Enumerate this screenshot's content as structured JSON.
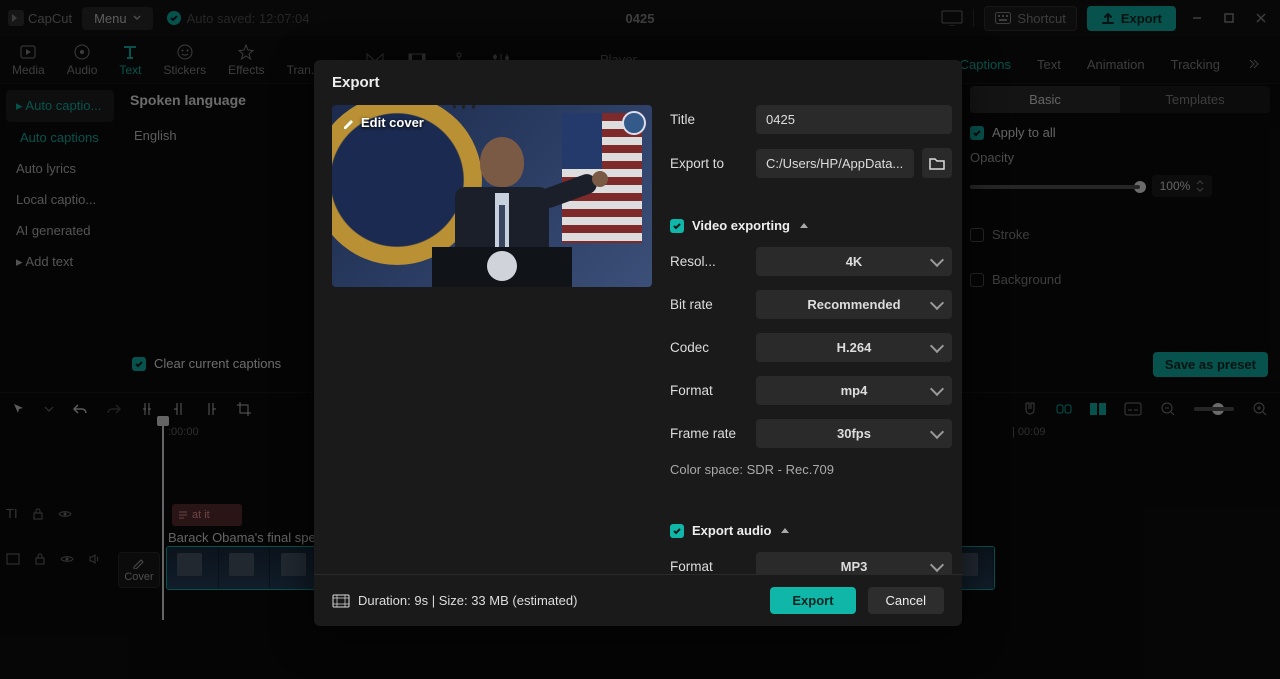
{
  "titlebar": {
    "brand": "CapCut",
    "menu": "Menu",
    "autosave": "Auto saved: 12:07:04",
    "document": "0425",
    "shortcut": "Shortcut",
    "export": "Export"
  },
  "toolTabs": {
    "media": "Media",
    "audio": "Audio",
    "text": "Text",
    "stickers": "Stickers",
    "effects": "Effects",
    "transitions": "Tran..."
  },
  "player_label": "Player",
  "rightTabs": {
    "captions": "Captions",
    "text": "Text",
    "animation": "Animation",
    "tracking": "Tracking"
  },
  "mediaSidebar": {
    "autoCaptionsPill": "▸ Auto captio...",
    "autoCaptions": "Auto captions",
    "autoLyrics": "Auto lyrics",
    "localCaptions": "Local captio...",
    "aiGenerated": "AI generated",
    "addText": "▸ Add text"
  },
  "langPanel": {
    "heading": "Spoken language",
    "value": "English"
  },
  "clearCaptions": "Clear current captions",
  "inspector": {
    "seg_basic": "Basic",
    "seg_templates": "Templates",
    "applyAll": "Apply to all",
    "opacity_label": "Opacity",
    "opacity_value": "100%",
    "stroke": "Stroke",
    "background": "Background",
    "savePreset": "Save as preset"
  },
  "timeline": {
    "marks": {
      "t0": ":00:00",
      "t9": "| 00:09"
    },
    "captionClip": "at it",
    "clipTitle": "Barack Obama's final speec",
    "coverBtn": "Cover"
  },
  "modal": {
    "title": "Export",
    "editCover": "Edit cover",
    "fields": {
      "title_label": "Title",
      "title_value": "0425",
      "exportTo_label": "Export to",
      "exportTo_value": "C:/Users/HP/AppData...",
      "videoExporting": "Video exporting",
      "resolution_label": "Resol...",
      "resolution_value": "4K",
      "bitrate_label": "Bit rate",
      "bitrate_value": "Recommended",
      "codec_label": "Codec",
      "codec_value": "H.264",
      "format_label": "Format",
      "format_value": "mp4",
      "framerate_label": "Frame rate",
      "framerate_value": "30fps",
      "colorspace": "Color space: SDR - Rec.709",
      "exportAudio": "Export audio",
      "audioFormat_label": "Format",
      "audioFormat_value": "MP3"
    },
    "footer": {
      "info": "Duration: 9s | Size: 33 MB (estimated)",
      "export": "Export",
      "cancel": "Cancel"
    }
  }
}
